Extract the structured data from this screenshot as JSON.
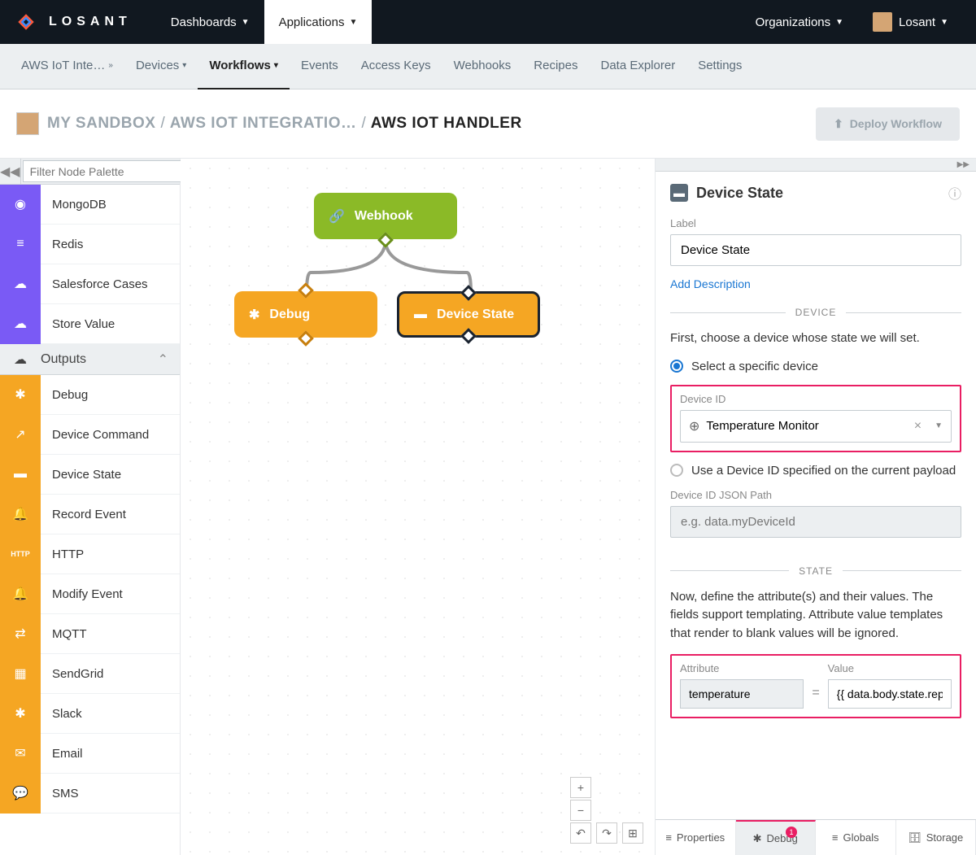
{
  "topnav": {
    "brand": "LOSANT",
    "items": [
      {
        "label": "Dashboards",
        "active": false
      },
      {
        "label": "Applications",
        "active": true
      }
    ],
    "right": {
      "org": "Organizations",
      "user": "Losant"
    }
  },
  "subnav": {
    "items": [
      {
        "label": "AWS IoT Inte…",
        "chev": true
      },
      {
        "label": "Devices",
        "chev": true
      },
      {
        "label": "Workflows",
        "chev": true,
        "active": true
      },
      {
        "label": "Events"
      },
      {
        "label": "Access Keys"
      },
      {
        "label": "Webhooks"
      },
      {
        "label": "Recipes"
      },
      {
        "label": "Data Explorer"
      },
      {
        "label": "Settings"
      }
    ]
  },
  "breadcrumb": {
    "items": [
      "MY SANDBOX",
      "AWS IOT INTEGRATIO…",
      "AWS IOT HANDLER"
    ],
    "deploy": "Deploy Workflow"
  },
  "palette": {
    "filter_placeholder": "Filter Node Palette",
    "section": "Outputs",
    "pre_items": [
      {
        "label": "MongoDB",
        "color": "purple"
      },
      {
        "label": "Redis",
        "color": "purple"
      },
      {
        "label": "Salesforce Cases",
        "color": "purple"
      },
      {
        "label": "Store Value",
        "color": "purple"
      }
    ],
    "outputs": [
      {
        "label": "Debug"
      },
      {
        "label": "Device Command"
      },
      {
        "label": "Device State"
      },
      {
        "label": "Record Event"
      },
      {
        "label": "HTTP"
      },
      {
        "label": "Modify Event"
      },
      {
        "label": "MQTT"
      },
      {
        "label": "SendGrid"
      },
      {
        "label": "Slack"
      },
      {
        "label": "Email"
      },
      {
        "label": "SMS"
      }
    ]
  },
  "canvas": {
    "webhook": "Webhook",
    "debug": "Debug",
    "device_state": "Device State"
  },
  "properties": {
    "title": "Device State",
    "label_label": "Label",
    "label_value": "Device State",
    "add_desc": "Add Description",
    "device_section": "DEVICE",
    "device_intro": "First, choose a device whose state we will set.",
    "radio_specific": "Select a specific device",
    "device_id_label": "Device ID",
    "device_selected": "Temperature Monitor",
    "radio_payload": "Use a Device ID specified on the current payload",
    "json_path_label": "Device ID JSON Path",
    "json_path_placeholder": "e.g. data.myDeviceId",
    "state_section": "STATE",
    "state_intro": "Now, define the attribute(s) and their values. The fields support templating. Attribute value templates that render to blank values will be ignored.",
    "attr_label": "Attribute",
    "value_label": "Value",
    "attr_value": "temperature",
    "value_value": "{{ data.body.state.reported.tem"
  },
  "tabs": {
    "properties": "Properties",
    "debug": "Debug",
    "debug_badge": "1",
    "globals": "Globals",
    "storage": "Storage"
  }
}
